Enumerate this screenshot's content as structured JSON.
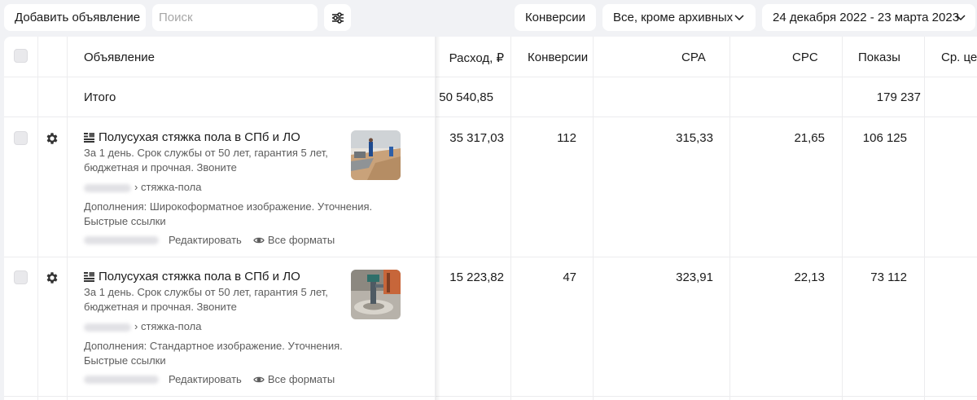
{
  "toolbar": {
    "add_label": "Добавить объявление",
    "search_placeholder": "Поиск",
    "conversions_label": "Конверсии",
    "status_filter": "Все, кроме архивных",
    "date_range": "24 декабря 2022 - 23 марта 2023"
  },
  "table": {
    "headers": {
      "ad": "Объявление",
      "spend": "Расход, ₽",
      "conversions": "Конверсии",
      "cpa": "CPA",
      "cpc": "CPC",
      "impressions": "Показы",
      "avg_price": "Ср. цен"
    },
    "total": {
      "label": "Итого",
      "spend": "50 540,85",
      "impressions": "179 237"
    },
    "rows": [
      {
        "title": "Полусухая стяжка пола в СПб и ЛО",
        "text": "За 1 день. Срок службы от 50 лет, гарантия 5 лет, бюджетная и прочная. Звоните",
        "url_path": "› стяжка-пола",
        "extras": "Дополнения: Широкоформатное изображение. Уточнения. Быстрые ссылки",
        "edit_label": "Редактировать",
        "formats_label": "Все форматы",
        "spend": "35 317,03",
        "conversions": "112",
        "cpa": "315,33",
        "cpc": "21,65",
        "impressions": "106 125"
      },
      {
        "title": "Полусухая стяжка пола в СПб и ЛО",
        "text": "За 1 день. Срок службы от 50 лет, гарантия 5 лет, бюджетная и прочная. Звоните",
        "url_path": "› стяжка-пола",
        "extras": "Дополнения: Стандартное изображение. Уточнения. Быстрые ссылки",
        "edit_label": "Редактировать",
        "formats_label": "Все форматы",
        "spend": "15 223,82",
        "conversions": "47",
        "cpa": "323,91",
        "cpc": "22,13",
        "impressions": "73 112"
      }
    ]
  },
  "icons": {
    "filter": "sliders-icon",
    "chevron": "chevron-down-icon",
    "settings": "gear-icon",
    "ad_type": "text-ad-icon",
    "formats": "eye-icon"
  }
}
